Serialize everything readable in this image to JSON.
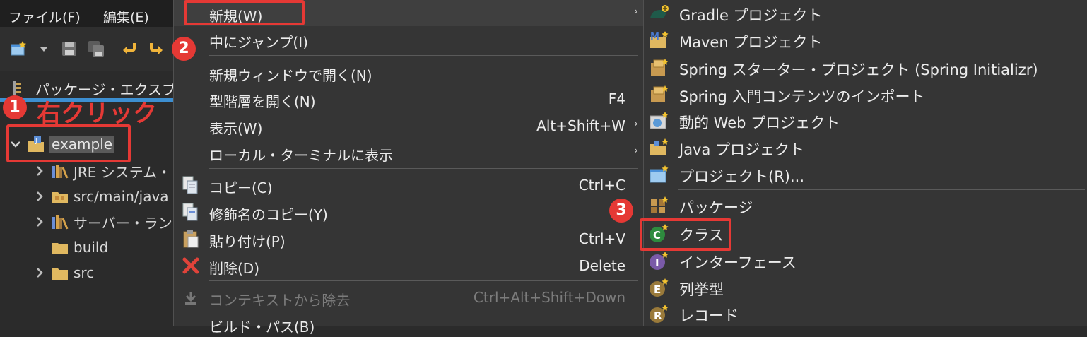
{
  "menubar": {
    "file": "ファイル(F)",
    "edit": "編集(E)"
  },
  "explorer": {
    "title": "パッケージ・エクスプロー"
  },
  "tree": {
    "project": "example",
    "children": [
      "JRE システム・ラ",
      "src/main/java",
      "サーバー・ランタイ",
      "build",
      "src"
    ]
  },
  "context_menu": {
    "new": "新規(W)",
    "goto": "中にジャンプ(I)",
    "open_new_window": "新規ウィンドウで開く(N)",
    "open_hierarchy": "型階層を開く(N)",
    "open_hierarchy_shortcut": "F4",
    "show": "表示(W)",
    "show_shortcut": "Alt+Shift+W",
    "local_terminal": "ローカル・ターミナルに表示",
    "copy": "コピー(C)",
    "copy_shortcut": "Ctrl+C",
    "copy_qualified": "修飾名のコピー(Y)",
    "paste": "貼り付け(P)",
    "paste_shortcut": "Ctrl+V",
    "delete": "削除(D)",
    "delete_shortcut": "Delete",
    "remove_context": "コンテキストから除去",
    "remove_context_shortcut": "Ctrl+Alt+Shift+Down",
    "build_path": "ビルド・パス(B)"
  },
  "submenu": {
    "gradle": "Gradle プロジェクト",
    "maven": "Maven プロジェクト",
    "spring_starter": "Spring スターター・プロジェクト (Spring Initializr)",
    "spring_guide": "Spring 入門コンテンツのインポート",
    "dynamic_web": "動的 Web プロジェクト",
    "java_project": "Java プロジェクト",
    "project": "プロジェクト(R)...",
    "package": "パッケージ",
    "class": "クラス",
    "interface": "インターフェース",
    "enum": "列挙型",
    "record": "レコード"
  },
  "annotations": {
    "step1": "1",
    "step1_text": "右クリック",
    "step2": "2",
    "step3": "3",
    "color": "#e53935"
  }
}
